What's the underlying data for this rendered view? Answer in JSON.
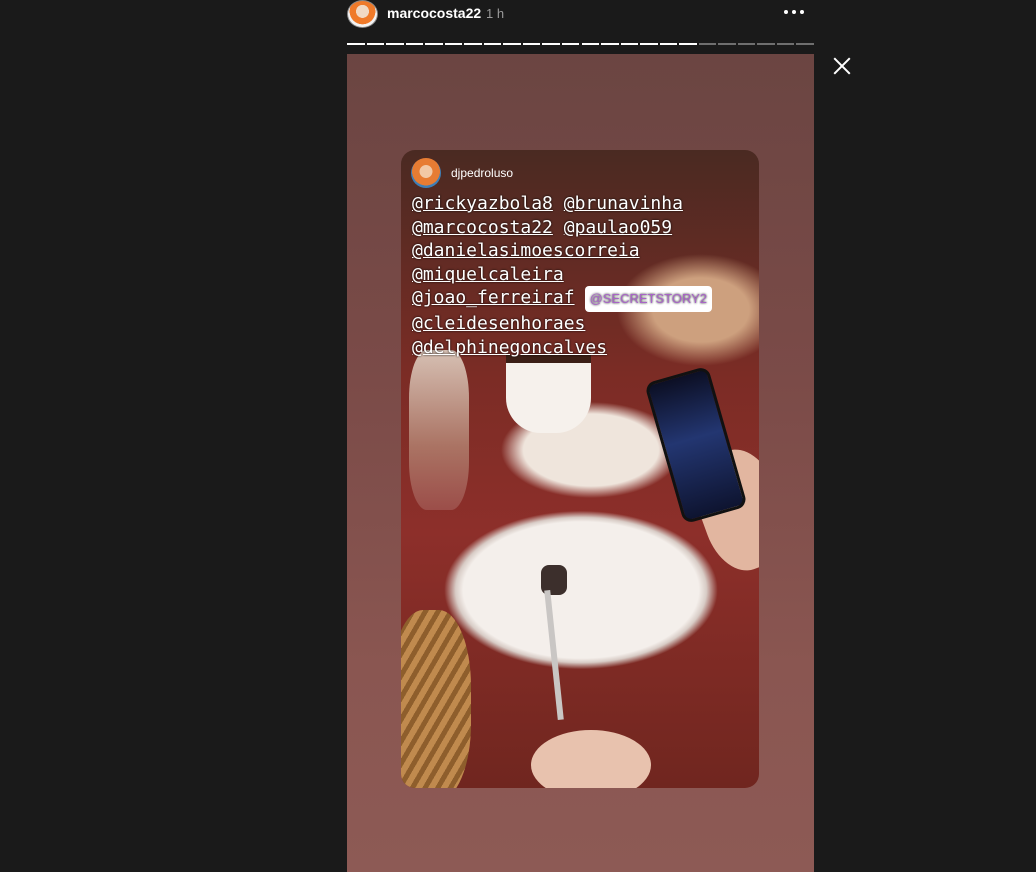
{
  "header": {
    "username": "marcocosta22",
    "time": "1 h",
    "more_icon": "more-horizontal-icon"
  },
  "progress": {
    "segments": 24,
    "seen": 18,
    "colors": {
      "seen": "#ffffff",
      "unseen": "#6f6f6f"
    }
  },
  "story": {
    "shared_from": "djpedroluso",
    "mentions": [
      [
        "@rickyazbola8",
        "@brunavinha"
      ],
      [
        "@marcocosta22",
        "@paulao059"
      ],
      [
        "@danielasimoescorreia"
      ],
      [
        "@miquelcaleira"
      ],
      [
        "@joao_ferreiraf"
      ],
      [
        "@cleidesenhoraes"
      ],
      [
        "@delphinegoncalves"
      ]
    ],
    "sticker": "@SECRETSTORY2"
  },
  "close_icon": "close-icon"
}
